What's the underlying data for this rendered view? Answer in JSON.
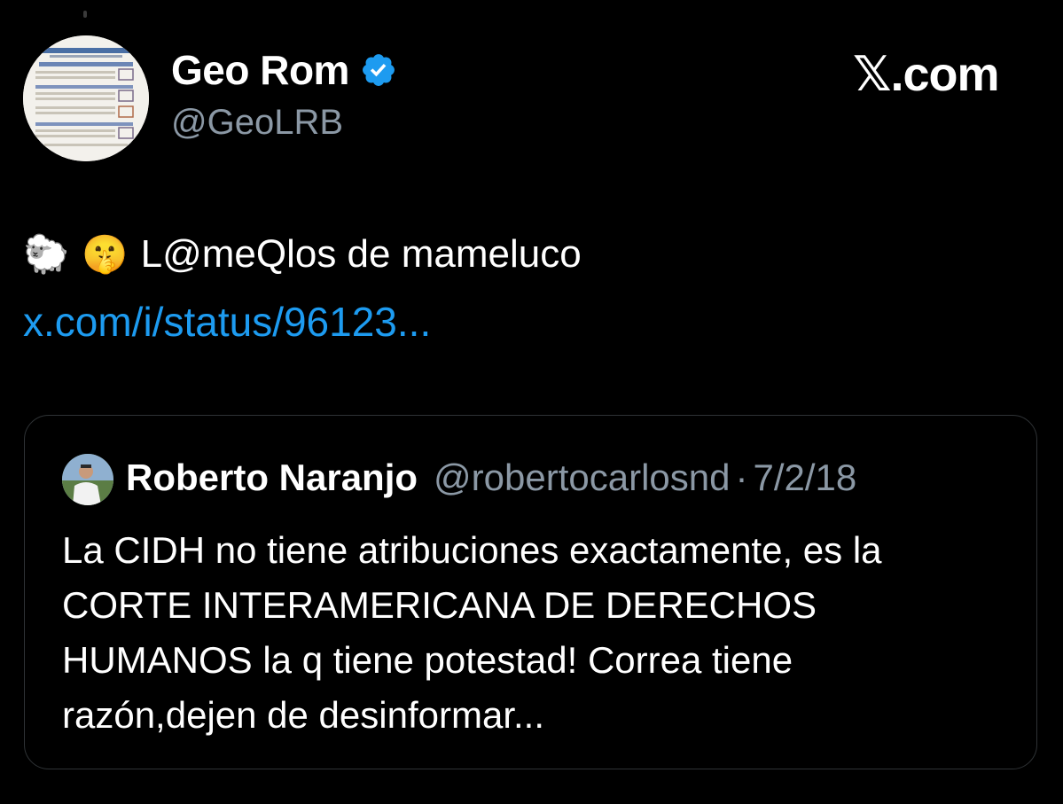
{
  "author": {
    "display_name": "Geo Rom",
    "handle": "@GeoLRB",
    "avatar_icon": "document-scan-avatar",
    "verified_icon": "verified-badge-icon",
    "verified_color": "#1d9bf0"
  },
  "brand": {
    "label": "𝕏.com"
  },
  "tweet": {
    "emoji_1": "🐑",
    "emoji_2": "🤫",
    "text": "L@meQlos de mameluco",
    "link_text": "x.com/i/status/96123...",
    "link_color": "#1d9bf0"
  },
  "quoted": {
    "display_name": "Roberto Naranjo",
    "handle": "@robertocarlosnd",
    "separator": "·",
    "date": "7/2/18",
    "avatar_icon": "person-photo-avatar",
    "lines": [
      "La CIDH no tiene atribuciones exactamente, es la",
      "CORTE INTERAMERICANA DE DERECHOS",
      "HUMANOS la q tiene potestad! Correa tiene",
      "razón,dejen de desinformar..."
    ]
  },
  "colors": {
    "background": "#000000",
    "secondary_text": "#8b98a5",
    "border": "#2f3336"
  }
}
